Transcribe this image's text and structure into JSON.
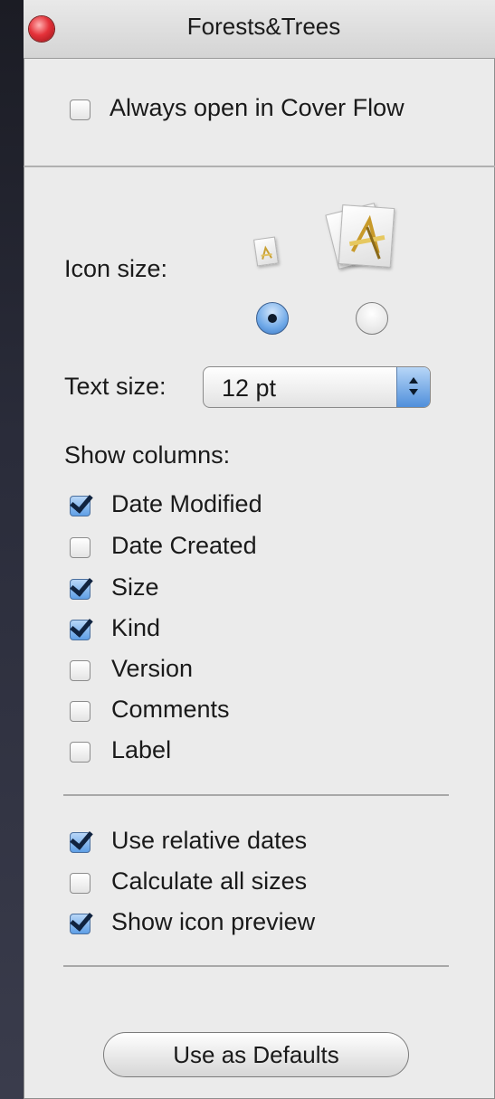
{
  "window": {
    "title": "Forests&Trees"
  },
  "cover_flow": {
    "label": "Always open in Cover Flow",
    "checked": false
  },
  "icon_size": {
    "label": "Icon size:",
    "small_icon": "document-icon",
    "large_icon": "document-icon",
    "selected": "small"
  },
  "text_size": {
    "label": "Text size:",
    "value": "12 pt"
  },
  "show_columns": {
    "label": "Show columns:",
    "items": [
      {
        "label": "Date Modified",
        "checked": true
      },
      {
        "label": "Date Created",
        "checked": false
      },
      {
        "label": "Size",
        "checked": true
      },
      {
        "label": "Kind",
        "checked": true
      },
      {
        "label": "Version",
        "checked": false
      },
      {
        "label": "Comments",
        "checked": false
      },
      {
        "label": "Label",
        "checked": false
      }
    ]
  },
  "options": [
    {
      "label": "Use relative dates",
      "checked": true
    },
    {
      "label": "Calculate all sizes",
      "checked": false
    },
    {
      "label": "Show icon preview",
      "checked": true
    }
  ],
  "defaults_button": {
    "label": "Use as Defaults"
  },
  "colors": {
    "accent": "#5f9fe6",
    "window_bg": "#ebebeb",
    "close_button": "#e5323a"
  }
}
